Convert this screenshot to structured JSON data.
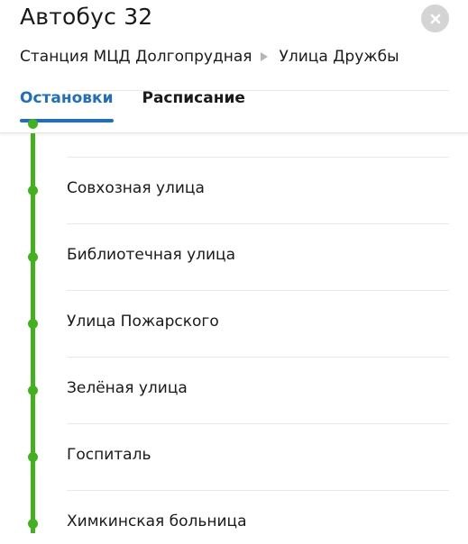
{
  "header": {
    "title": "Автобус 32",
    "route_from": "Станция МЦД Долгопрудная",
    "route_to": "Улица Дружбы",
    "close_icon": "close-icon"
  },
  "tabs": [
    {
      "label": "Остановки",
      "active": true
    },
    {
      "label": "Расписание",
      "active": false
    }
  ],
  "colors": {
    "accent": "#1f6fbf",
    "route_line": "#42b21c",
    "close_bg": "#d4d4d4"
  },
  "stops": [
    {
      "name": ""
    },
    {
      "name": "Совхозная улица"
    },
    {
      "name": "Библиотечная улица"
    },
    {
      "name": "Улица Пожарского"
    },
    {
      "name": "Зелёная улица"
    },
    {
      "name": "Госпиталь"
    },
    {
      "name": "Химкинская больница"
    }
  ]
}
